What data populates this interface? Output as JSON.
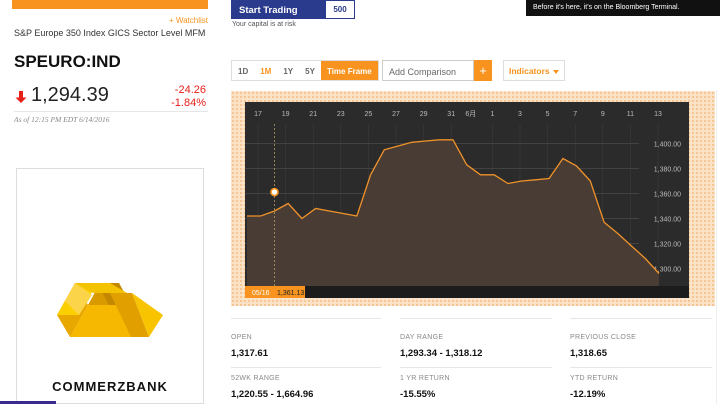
{
  "watchlist": {
    "label": "+ Watchlist"
  },
  "security": {
    "name": "S&P Europe 350 Index GICS Sector Level MFM",
    "ticker": "SPEURO:IND",
    "price": "1,294.39",
    "change": "-24.26",
    "change_pct": "-1.84%",
    "as_of": "As of 12:15 PM EDT 6/14/2016",
    "direction": "down"
  },
  "ads": {
    "trade_button": "Start Trading",
    "trade_logo": "500",
    "capital_risk": "Your capital is at risk",
    "bloomberg_banner": "Before it's here, it's on the Bloomberg Terminal.",
    "commerzbank": "COMMERZBANK"
  },
  "controls": {
    "timeframes": [
      "1D",
      "1M",
      "1Y",
      "5Y"
    ],
    "active_timeframe": "1M",
    "time_frame_label": "Time Frame",
    "add_comparison": "Add Comparison",
    "add_plus": "+",
    "indicators": "Indicators"
  },
  "chart_data": {
    "type": "area",
    "x_tick_labels": [
      "17",
      "19",
      "21",
      "23",
      "25",
      "27",
      "29",
      "31",
      "6月",
      "1",
      "3",
      "5",
      "7",
      "9",
      "11",
      "13"
    ],
    "y_tick_labels": [
      "1,400.00",
      "1,380.00",
      "1,360.00",
      "1,340.00",
      "1,320.00",
      "1,300.00"
    ],
    "ylim": [
      1286,
      1418
    ],
    "series": [
      {
        "values": [
          1342,
          1342,
          1346,
          1352,
          1340,
          1348,
          1346,
          1344,
          1342,
          1375,
          1395,
          1398,
          1401,
          1402,
          1403,
          1403,
          1383,
          1375,
          1375,
          1368,
          1370,
          1371,
          1372,
          1388,
          1382,
          1370,
          1337,
          1328,
          1318,
          1308,
          1296
        ]
      }
    ],
    "hover": {
      "date": "05/16",
      "value": "1,361.13",
      "value_num": 1361.13,
      "index": 2
    },
    "grid": true,
    "colors": {
      "line": "#f0922a",
      "area": "#4a3d35",
      "background": "#2b2b2b",
      "accent": "#f7931e"
    }
  },
  "stats": [
    {
      "label": "OPEN",
      "value": "1,317.61"
    },
    {
      "label": "DAY RANGE",
      "value": "1,293.34 - 1,318.12"
    },
    {
      "label": "PREVIOUS CLOSE",
      "value": "1,318.65"
    },
    {
      "label": "52WK RANGE",
      "value": "1,220.55 - 1,664.96"
    },
    {
      "label": "1 YR RETURN",
      "value": "-15.55%"
    },
    {
      "label": "YTD RETURN",
      "value": "-12.19%"
    }
  ]
}
